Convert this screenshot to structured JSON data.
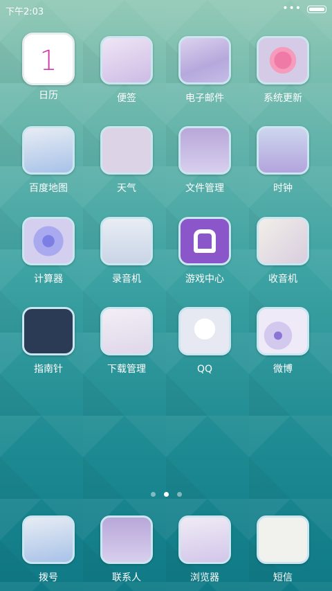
{
  "status": {
    "time": "下午2:03",
    "dots": "•••"
  },
  "apps": [
    {
      "label": "日历",
      "icon": "calendar-icon",
      "glyph": "1"
    },
    {
      "label": "便签",
      "icon": "notes-icon"
    },
    {
      "label": "电子邮件",
      "icon": "email-icon"
    },
    {
      "label": "系统更新",
      "icon": "system-update-icon"
    },
    {
      "label": "百度地图",
      "icon": "baidu-map-icon"
    },
    {
      "label": "天气",
      "icon": "weather-icon"
    },
    {
      "label": "文件管理",
      "icon": "file-manager-icon"
    },
    {
      "label": "时钟",
      "icon": "clock-icon"
    },
    {
      "label": "计算器",
      "icon": "calculator-icon"
    },
    {
      "label": "录音机",
      "icon": "recorder-icon"
    },
    {
      "label": "游戏中心",
      "icon": "game-center-icon"
    },
    {
      "label": "收音机",
      "icon": "radio-icon"
    },
    {
      "label": "指南针",
      "icon": "compass-icon"
    },
    {
      "label": "下载管理",
      "icon": "download-manager-icon"
    },
    {
      "label": "QQ",
      "icon": "qq-icon"
    },
    {
      "label": "微博",
      "icon": "weibo-icon"
    }
  ],
  "page_indicator": {
    "count": 3,
    "active": 2
  },
  "dock": [
    {
      "label": "拨号",
      "icon": "dialer-icon"
    },
    {
      "label": "联系人",
      "icon": "contacts-icon"
    },
    {
      "label": "浏览器",
      "icon": "browser-icon"
    },
    {
      "label": "短信",
      "icon": "messages-icon"
    }
  ],
  "colors": {
    "wallpaper_top": "#93c9b6",
    "wallpaper_bottom": "#0f7a86",
    "calendar_digit": "#d23aa7",
    "game_center_bg": "#8a56c9",
    "icon_border": "#c9e7f1"
  }
}
